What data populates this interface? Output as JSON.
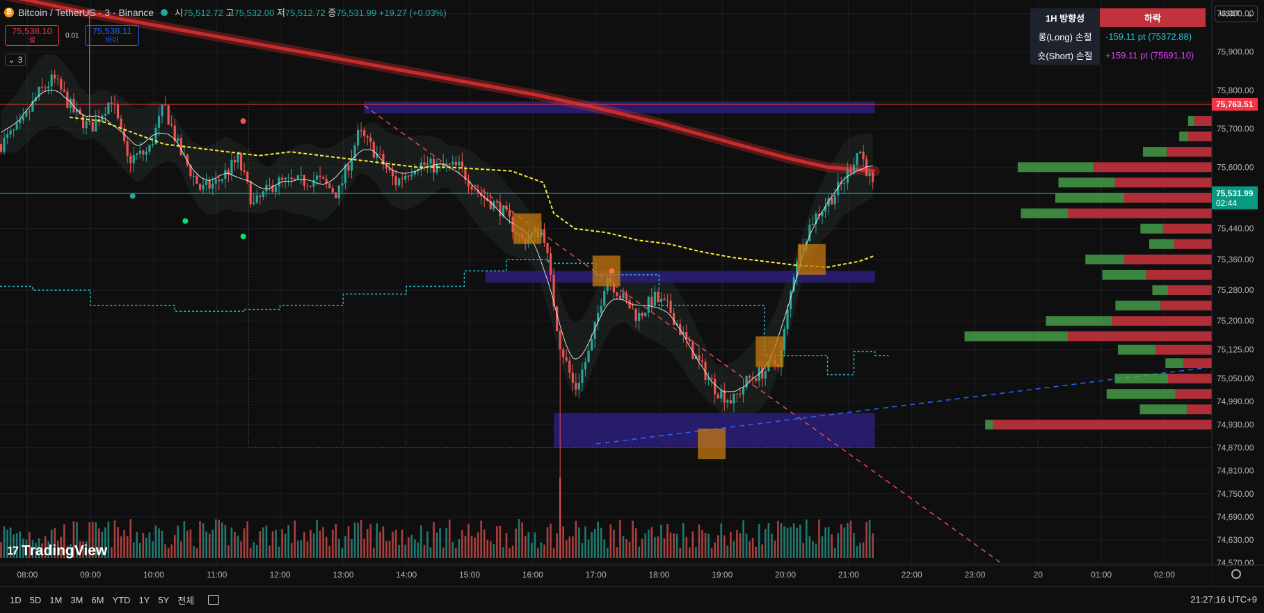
{
  "header": {
    "symbol": "Bitcoin / TetherUS · 3 · Binance",
    "coin_glyph": "₿",
    "ohlc": [
      {
        "label": "시",
        "value": "75,512.72"
      },
      {
        "label": "고",
        "value": "75,532.00"
      },
      {
        "label": "저",
        "value": "75,512.72"
      },
      {
        "label": "종",
        "value": "75,531.99"
      }
    ],
    "change": "+19.27 (+0.03%)"
  },
  "trade": {
    "sell_price": "75,538.10",
    "sell_label": "셀",
    "spread": "0.01",
    "buy_price": "75,538.11",
    "buy_label": "바이"
  },
  "indicators_collapsed": {
    "count": "3",
    "glyph": "⌄"
  },
  "info_table": {
    "header_label": "1H 방향성",
    "header_value": "하락",
    "long_label": "롱(Long) 손절",
    "long_value": "-159.11 pt (75372.88)",
    "short_label": "숏(Short) 손절",
    "short_value": "+159.11 pt (75691.10)"
  },
  "currency_selector": {
    "value": "USDT",
    "glyph": "⌄"
  },
  "colors": {
    "bull": "#26a69a",
    "bear": "#ef5350",
    "ema_red": "#d32f2f",
    "yellow_ma": "#ffeb3b",
    "cyan_line": "#26c6da",
    "zone_blue": "#2a1f7a",
    "orange_box": "#c77a0e",
    "last_price_bg": "#089981",
    "red_line": "#f23645"
  },
  "chart_data": {
    "type": "candlestick",
    "symbol": "BTCUSDT",
    "interval": "3",
    "y_axis_ticks": [
      "76,000.00",
      "75,900.00",
      "75,800.00",
      "75,700.00",
      "75,600.00",
      "75,440.00",
      "75,360.00",
      "75,280.00",
      "75,200.00",
      "75,125.00",
      "75,050.00",
      "74,990.00",
      "74,930.00",
      "74,870.00",
      "74,810.00",
      "74,750.00",
      "74,690.00",
      "74,630.00",
      "74,570.00"
    ],
    "x_axis_ticks": [
      "08:00",
      "09:00",
      "10:00",
      "11:00",
      "12:00",
      "13:00",
      "14:00",
      "15:00",
      "16:00",
      "17:00",
      "18:00",
      "19:00",
      "20:00",
      "21:00",
      "22:00",
      "23:00",
      "20",
      "01:00",
      "02:00"
    ],
    "ylim": [
      74565,
      76035
    ],
    "xlim": [
      "07:34",
      "02:45"
    ],
    "price_anchors": [
      [
        "07:35",
        75660
      ],
      [
        "07:55",
        75710
      ],
      [
        "08:10",
        75790
      ],
      [
        "08:25",
        75830
      ],
      [
        "08:45",
        75740
      ],
      [
        "09:00",
        75700
      ],
      [
        "09:20",
        75780
      ],
      [
        "09:35",
        75620
      ],
      [
        "09:55",
        75640
      ],
      [
        "10:10",
        75760
      ],
      [
        "10:25",
        75640
      ],
      [
        "10:45",
        75540
      ],
      [
        "11:00",
        75560
      ],
      [
        "11:20",
        75620
      ],
      [
        "11:35",
        75500
      ],
      [
        "11:55",
        75560
      ],
      [
        "12:15",
        75560
      ],
      [
        "12:35",
        75570
      ],
      [
        "12:55",
        75530
      ],
      [
        "13:15",
        75690
      ],
      [
        "13:30",
        75640
      ],
      [
        "13:50",
        75560
      ],
      [
        "14:10",
        75610
      ],
      [
        "14:30",
        75600
      ],
      [
        "14:50",
        75600
      ],
      [
        "15:10",
        75530
      ],
      [
        "15:30",
        75490
      ],
      [
        "15:50",
        75410
      ],
      [
        "16:10",
        75440
      ],
      [
        "16:25",
        75150
      ],
      [
        "16:40",
        75020
      ],
      [
        "16:55",
        75130
      ],
      [
        "17:10",
        75320
      ],
      [
        "17:25",
        75260
      ],
      [
        "17:40",
        75210
      ],
      [
        "17:55",
        75260
      ],
      [
        "18:10",
        75230
      ],
      [
        "18:25",
        75150
      ],
      [
        "18:40",
        75080
      ],
      [
        "18:55",
        75020
      ],
      [
        "19:10",
        74990
      ],
      [
        "19:25",
        75050
      ],
      [
        "19:40",
        75070
      ],
      [
        "19:55",
        75100
      ],
      [
        "20:10",
        75360
      ],
      [
        "20:25",
        75460
      ],
      [
        "20:40",
        75510
      ],
      [
        "20:55",
        75560
      ],
      [
        "21:10",
        75650
      ],
      [
        "21:25",
        75532
      ]
    ],
    "last_price": {
      "value": "75,531.99",
      "countdown": "02:44"
    },
    "red_level": {
      "value": "75,763.51"
    },
    "ema_long": [
      [
        "07:34",
        76050
      ],
      [
        "09:00",
        76000
      ],
      [
        "10:00",
        75970
      ],
      [
        "11:00",
        75940
      ],
      [
        "12:00",
        75910
      ],
      [
        "13:00",
        75880
      ],
      [
        "14:00",
        75850
      ],
      [
        "15:00",
        75820
      ],
      [
        "16:00",
        75790
      ],
      [
        "17:00",
        75755
      ],
      [
        "18:00",
        75715
      ],
      [
        "19:00",
        75670
      ],
      [
        "20:00",
        75625
      ],
      [
        "20:40",
        75600
      ],
      [
        "21:25",
        75590
      ]
    ],
    "yellow_ma": [
      [
        "08:40",
        75730
      ],
      [
        "09:10",
        75720
      ],
      [
        "09:40",
        75690
      ],
      [
        "10:10",
        75660
      ],
      [
        "10:40",
        75650
      ],
      [
        "11:10",
        75640
      ],
      [
        "11:40",
        75630
      ],
      [
        "12:10",
        75640
      ],
      [
        "12:40",
        75630
      ],
      [
        "13:10",
        75620
      ],
      [
        "13:40",
        75610
      ],
      [
        "14:10",
        75600
      ],
      [
        "14:40",
        75600
      ],
      [
        "15:10",
        75595
      ],
      [
        "15:40",
        75590
      ],
      [
        "16:10",
        75560
      ],
      [
        "16:20",
        75480
      ],
      [
        "16:40",
        75440
      ],
      [
        "17:10",
        75430
      ],
      [
        "17:40",
        75410
      ],
      [
        "18:10",
        75400
      ],
      [
        "18:40",
        75380
      ],
      [
        "19:10",
        75365
      ],
      [
        "19:40",
        75355
      ],
      [
        "20:10",
        75345
      ],
      [
        "20:40",
        75340
      ],
      [
        "21:10",
        75355
      ],
      [
        "21:25",
        75370
      ]
    ],
    "cyan_steps": [
      [
        "07:34",
        75290
      ],
      [
        "08:05",
        75280
      ],
      [
        "09:00",
        75240
      ],
      [
        "10:20",
        75225
      ],
      [
        "11:25",
        75230
      ],
      [
        "12:00",
        75240
      ],
      [
        "13:00",
        75270
      ],
      [
        "14:00",
        75290
      ],
      [
        "14:55",
        75330
      ],
      [
        "15:35",
        75360
      ],
      [
        "16:15",
        75350
      ],
      [
        "17:00",
        75320
      ],
      [
        "18:00",
        75240
      ],
      [
        "19:40",
        75110
      ],
      [
        "20:40",
        75060
      ],
      [
        "21:05",
        75120
      ],
      [
        "21:25",
        75110
      ]
    ],
    "zones": [
      {
        "from": "13:20",
        "to": "21:25",
        "low": 75740,
        "high": 75770
      },
      {
        "from": "15:15",
        "to": "21:25",
        "low": 75300,
        "high": 75330
      },
      {
        "from": "16:20",
        "to": "21:25",
        "low": 74870,
        "high": 74960
      }
    ],
    "volume_profile": [
      {
        "price": 75720,
        "buy": 10,
        "sell": 28
      },
      {
        "price": 75680,
        "buy": 14,
        "sell": 38
      },
      {
        "price": 75640,
        "buy": 38,
        "sell": 72
      },
      {
        "price": 75600,
        "buy": 120,
        "sell": 190
      },
      {
        "price": 75560,
        "buy": 90,
        "sell": 155
      },
      {
        "price": 75520,
        "buy": 110,
        "sell": 140
      },
      {
        "price": 75480,
        "buy": 75,
        "sell": 230
      },
      {
        "price": 75440,
        "buy": 36,
        "sell": 78
      },
      {
        "price": 75400,
        "buy": 40,
        "sell": 60
      },
      {
        "price": 75360,
        "buy": 62,
        "sell": 140
      },
      {
        "price": 75320,
        "buy": 70,
        "sell": 105
      },
      {
        "price": 75280,
        "buy": 25,
        "sell": 70
      },
      {
        "price": 75240,
        "buy": 72,
        "sell": 82
      },
      {
        "price": 75200,
        "buy": 105,
        "sell": 160
      },
      {
        "price": 75160,
        "buy": 165,
        "sell": 230
      },
      {
        "price": 75125,
        "buy": 60,
        "sell": 90
      },
      {
        "price": 75090,
        "buy": 28,
        "sell": 46
      },
      {
        "price": 75050,
        "buy": 85,
        "sell": 70
      },
      {
        "price": 75010,
        "buy": 110,
        "sell": 58
      },
      {
        "price": 74970,
        "buy": 75,
        "sell": 40
      },
      {
        "price": 74930,
        "buy": 12,
        "sell": 350
      }
    ]
  },
  "watermark": {
    "text": "TradingView",
    "mark": "17"
  },
  "bottom_bar": {
    "ranges": [
      "1D",
      "5D",
      "1M",
      "3M",
      "6M",
      "YTD",
      "1Y",
      "5Y",
      "전체"
    ],
    "clock": "21:27:16 UTC+9"
  }
}
